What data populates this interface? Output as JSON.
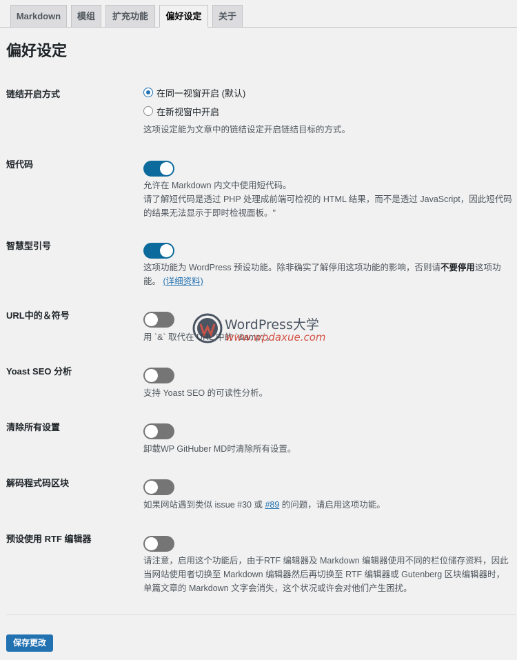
{
  "tabs": [
    {
      "label": "Markdown"
    },
    {
      "label": "模组"
    },
    {
      "label": "扩充功能"
    },
    {
      "label": "偏好设定"
    },
    {
      "label": "关于"
    }
  ],
  "active_tab": "偏好设定",
  "page_title": "偏好设定",
  "link_open": {
    "label": "链结开启方式",
    "option_same": "在同一视窗开启 (默认)",
    "option_new": "在新视窗中开启",
    "selected": "same",
    "desc": "这项设定能为文章中的链结设定开启链结目标的方式。"
  },
  "shortcode": {
    "label": "短代码",
    "enabled": true,
    "desc1": "允许在 Markdown 内文中使用短代码。",
    "desc2": "请了解短代码是透过 PHP 处理成前端可检视的 HTML 结果，而不是透过 JavaScript，因此短代码的结果无法显示于即时检视面板。\""
  },
  "smart_quotes": {
    "label": "智慧型引号",
    "enabled": true,
    "desc_prefix": "这项功能为 WordPress 预设功能。除非确实了解停用这项功能的影响，否则请",
    "desc_bold": "不要停用",
    "desc_suffix": "这项功能。",
    "desc_link": "(详细资料)"
  },
  "url_amp": {
    "label": "URL中的＆符号",
    "enabled": false,
    "desc": "用 `&` 取代在 URL 中的 `&amp;`。"
  },
  "yoast": {
    "label": "Yoast SEO 分析",
    "enabled": false,
    "desc": "支持 Yoast SEO 的可读性分析。"
  },
  "clear_settings": {
    "label": "清除所有设置",
    "enabled": false,
    "desc": "卸载WP GitHuber MD时清除所有设置。"
  },
  "decode_code": {
    "label": "解码程式码区块",
    "enabled": false,
    "desc_prefix": "如果网站遇到类似 issue #30 或 ",
    "desc_link": "#89",
    "desc_suffix": " 的问题，请启用这项功能。"
  },
  "rtf_default": {
    "label": "预设使用 RTF 编辑器",
    "enabled": false,
    "desc": "请注意，启用这个功能后，由于RTF 编辑器及 Markdown 编辑器使用不同的栏位储存资料，因此当网站使用者切换至 Markdown 编辑器然后再切换至 RTF 编辑器或 Gutenberg 区块编辑器时，单篇文章的 Markdown 文字会消失，这个状况或许会对他们产生困扰。"
  },
  "save_button": "保存更改",
  "watermark": {
    "line1": "WordPress大学",
    "line2": "www.wpdaxue.com"
  },
  "colors": {
    "accent": "#2271b1",
    "toggle_on": "#0c6b9c",
    "toggle_off": "#757575",
    "background": "#f1f1f1"
  }
}
